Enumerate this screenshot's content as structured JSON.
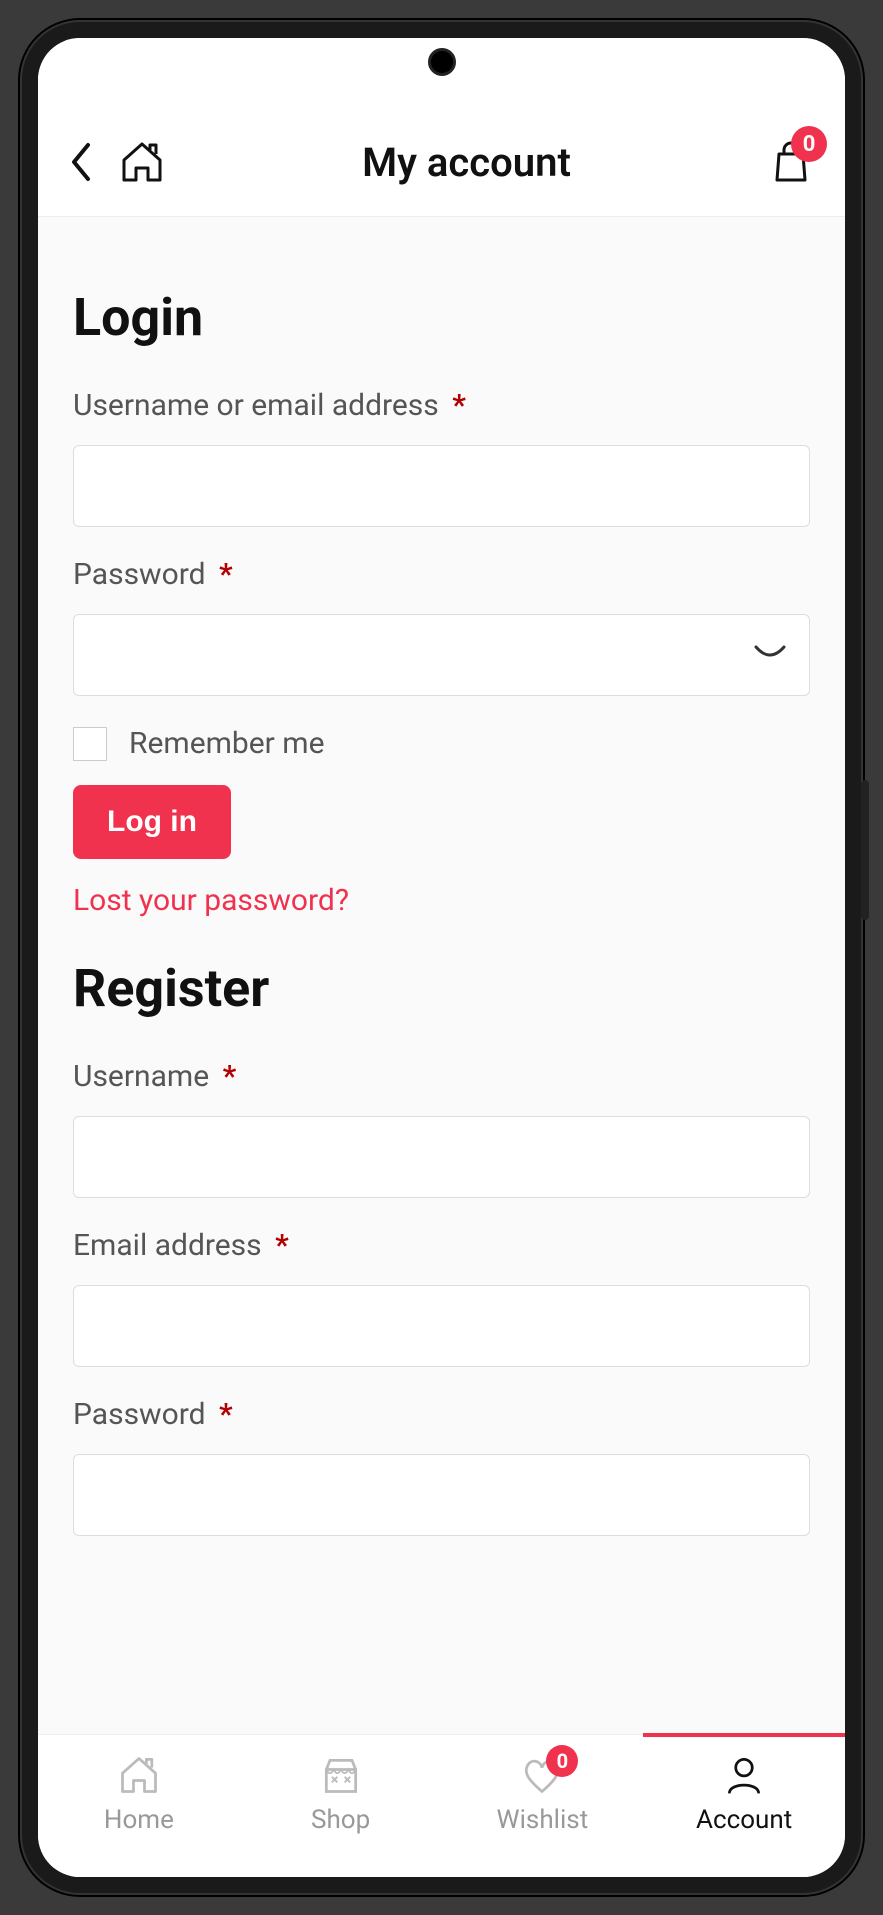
{
  "header": {
    "title": "My account",
    "cart_count": "0"
  },
  "login": {
    "heading": "Login",
    "username_label": "Username or email address",
    "password_label": "Password",
    "remember_label": "Remember me",
    "submit_label": "Log in",
    "lost_pw_label": "Lost your password?"
  },
  "register": {
    "heading": "Register",
    "username_label": "Username",
    "email_label": "Email address",
    "password_label": "Password"
  },
  "required_marker": "*",
  "nav": {
    "home": "Home",
    "shop": "Shop",
    "wishlist": "Wishlist",
    "wishlist_count": "0",
    "account": "Account"
  },
  "colors": {
    "accent": "#f0324f"
  }
}
